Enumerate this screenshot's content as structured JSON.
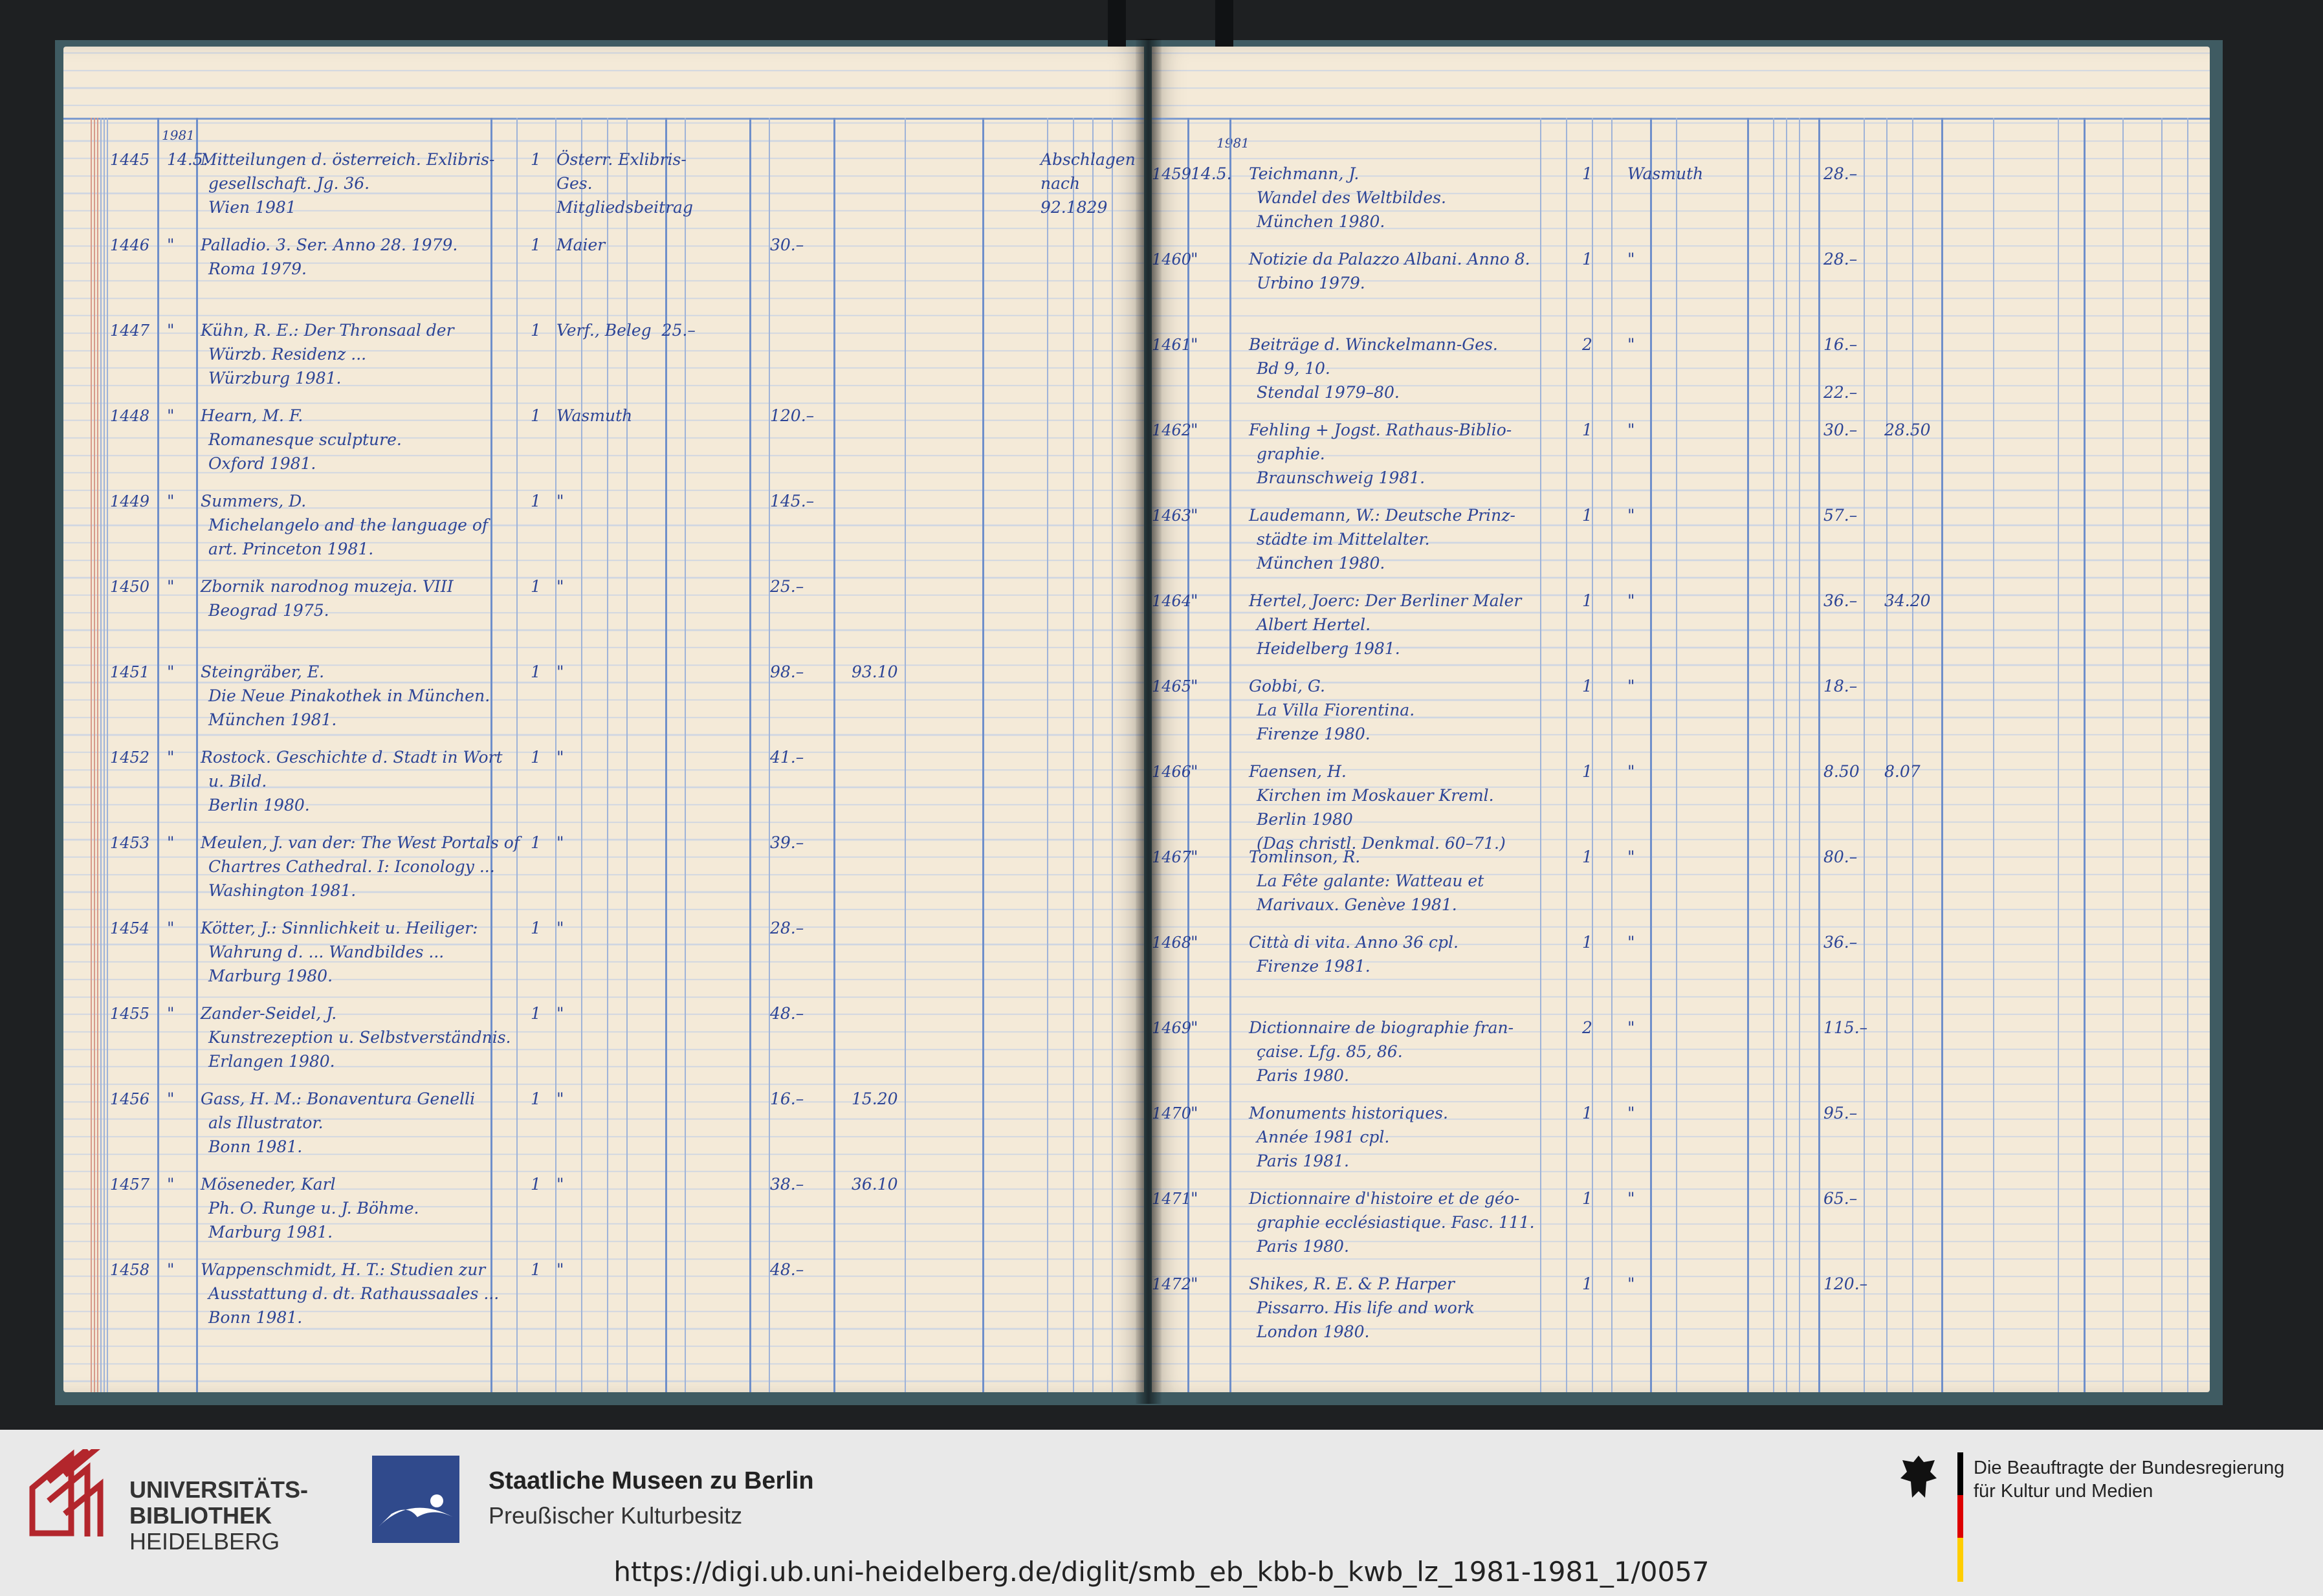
{
  "header": {
    "year_left": "1981",
    "year_right": "1981"
  },
  "left_entries": [
    {
      "no": "1445",
      "date": "14.5.",
      "title": [
        "Mitteilungen d. österreich. Exlibris-",
        "gesellschaft. Jg. 36.",
        "Wien 1981"
      ],
      "qty": "1",
      "supplier": [
        "Österr. Exlibris-",
        "Ges.",
        "Mitgliedsbeitrag"
      ],
      "price": "",
      "remark": [
        "Abschlagen",
        "nach",
        "92.1829"
      ]
    },
    {
      "no": "1446",
      "date": "\"",
      "title": [
        "Palladio. 3. Ser. Anno 28. 1979.",
        "Roma 1979."
      ],
      "qty": "1",
      "supplier": [
        "Maier"
      ],
      "price": "30.–",
      "remark": []
    },
    {
      "no": "1447",
      "date": "\"",
      "title": [
        "Kühn, R. E.: Der Thronsaal der",
        "Würzb. Residenz ...",
        "Würzburg 1981."
      ],
      "qty": "1",
      "supplier": [
        "Verf., Beleg  25.–"
      ],
      "price": "",
      "remark": []
    },
    {
      "no": "1448",
      "date": "\"",
      "title": [
        "Hearn, M. F.",
        "Romanesque sculpture.",
        "Oxford 1981."
      ],
      "qty": "1",
      "supplier": [
        "Wasmuth"
      ],
      "price": "120.–",
      "remark": []
    },
    {
      "no": "1449",
      "date": "\"",
      "title": [
        "Summers, D.",
        "Michelangelo and the language of",
        "art. Princeton 1981."
      ],
      "qty": "1",
      "supplier": [
        "\""
      ],
      "price": "145.–",
      "remark": []
    },
    {
      "no": "1450",
      "date": "\"",
      "title": [
        "Zbornik narodnog muzeja. VIII",
        "Beograd 1975."
      ],
      "qty": "1",
      "supplier": [
        "\""
      ],
      "price": "25.–",
      "remark": []
    },
    {
      "no": "1451",
      "date": "\"",
      "title": [
        "Steingräber, E.",
        "Die Neue Pinakothek in München.",
        "München 1981."
      ],
      "qty": "1",
      "supplier": [
        "\""
      ],
      "price": "98.–",
      "net": "93.10",
      "remark": []
    },
    {
      "no": "1452",
      "date": "\"",
      "title": [
        "Rostock. Geschichte d. Stadt in Wort",
        "u. Bild.",
        "Berlin 1980."
      ],
      "qty": "1",
      "supplier": [
        "\""
      ],
      "price": "41.–",
      "remark": []
    },
    {
      "no": "1453",
      "date": "\"",
      "title": [
        "Meulen, J. van der: The West Portals of",
        "Chartres Cathedral. I: Iconology ...",
        "Washington 1981."
      ],
      "qty": "1",
      "supplier": [
        "\""
      ],
      "price": "39.–",
      "remark": []
    },
    {
      "no": "1454",
      "date": "\"",
      "title": [
        "Kötter, J.: Sinnlichkeit u. Heiliger:",
        "Wahrung d. ... Wandbildes ...",
        "Marburg 1980."
      ],
      "qty": "1",
      "supplier": [
        "\""
      ],
      "price": "28.–",
      "remark": []
    },
    {
      "no": "1455",
      "date": "\"",
      "title": [
        "Zander-Seidel, J.",
        "Kunstrezeption u. Selbstverständnis.",
        "Erlangen 1980."
      ],
      "qty": "1",
      "supplier": [
        "\""
      ],
      "price": "48.–",
      "remark": []
    },
    {
      "no": "1456",
      "date": "\"",
      "title": [
        "Gass, H. M.: Bonaventura Genelli",
        "als Illustrator.",
        "Bonn 1981."
      ],
      "qty": "1",
      "supplier": [
        "\""
      ],
      "price": "16.–",
      "net": "15.20",
      "remark": []
    },
    {
      "no": "1457",
      "date": "\"",
      "title": [
        "Möseneder, Karl",
        "Ph. O. Runge u. J. Böhme.",
        "Marburg 1981."
      ],
      "qty": "1",
      "supplier": [
        "\""
      ],
      "price": "38.–",
      "net": "36.10",
      "remark": []
    },
    {
      "no": "1458",
      "date": "\"",
      "title": [
        "Wappenschmidt, H. T.: Studien zur",
        "Ausstattung d. dt. Rathaussaales ...",
        "Bonn 1981."
      ],
      "qty": "1",
      "supplier": [
        "\""
      ],
      "price": "48.–",
      "remark": []
    }
  ],
  "right_entries": [
    {
      "no": "1459",
      "date": "14.5.",
      "title": [
        "Teichmann, J.",
        "Wandel des Weltbildes.",
        "München 1980."
      ],
      "qty": "1",
      "supplier": [
        "Wasmuth"
      ],
      "price": "28.–"
    },
    {
      "no": "1460",
      "date": "\"",
      "title": [
        "Notizie da Palazzo Albani. Anno 8.",
        "Urbino 1979."
      ],
      "qty": "1",
      "supplier": [
        "\""
      ],
      "price": "28.–"
    },
    {
      "no": "1461",
      "date": "\"",
      "title": [
        "Beiträge d. Winckelmann-Ges.",
        "Bd 9, 10.",
        "Stendal 1979–80."
      ],
      "qty": "2",
      "supplier": [
        "\""
      ],
      "price": "16.–",
      "price2": "22.–"
    },
    {
      "no": "1462",
      "date": "\"",
      "title": [
        "Fehling + Jogst. Rathaus-Biblio-",
        "graphie.",
        "Braunschweig 1981."
      ],
      "qty": "1",
      "supplier": [
        "\""
      ],
      "price": "30.–",
      "net": "28.50"
    },
    {
      "no": "1463",
      "date": "\"",
      "title": [
        "Laudemann, W.: Deutsche Prinz-",
        "städte im Mittelalter.",
        "München 1980."
      ],
      "qty": "1",
      "supplier": [
        "\""
      ],
      "price": "57.–"
    },
    {
      "no": "1464",
      "date": "\"",
      "title": [
        "Hertel, Joerc: Der Berliner Maler",
        "Albert Hertel.",
        "Heidelberg 1981."
      ],
      "qty": "1",
      "supplier": [
        "\""
      ],
      "price": "36.–",
      "net": "34.20"
    },
    {
      "no": "1465",
      "date": "\"",
      "title": [
        "Gobbi, G.",
        "La Villa Fiorentina.",
        "Firenze 1980."
      ],
      "qty": "1",
      "supplier": [
        "\""
      ],
      "price": "18.–"
    },
    {
      "no": "1466",
      "date": "\"",
      "title": [
        "Faensen, H.",
        "Kirchen im Moskauer Kreml.",
        "Berlin 1980",
        "(Das christl. Denkmal. 60–71.)"
      ],
      "qty": "1",
      "supplier": [
        "\""
      ],
      "price": "8.50",
      "net": "8.07"
    },
    {
      "no": "1467",
      "date": "\"",
      "title": [
        "Tomlinson, R.",
        "La Fête galante: Watteau et",
        "Marivaux. Genève 1981."
      ],
      "qty": "1",
      "supplier": [
        "\""
      ],
      "price": "80.–"
    },
    {
      "no": "1468",
      "date": "\"",
      "title": [
        "Città di vita. Anno 36 cpl.",
        "Firenze 1981."
      ],
      "qty": "1",
      "supplier": [
        "\""
      ],
      "price": "36.–"
    },
    {
      "no": "1469",
      "date": "\"",
      "title": [
        "Dictionnaire de biographie fran-",
        "çaise. Lfg. 85, 86.",
        "Paris 1980."
      ],
      "qty": "2",
      "supplier": [
        "\""
      ],
      "price": "115.–"
    },
    {
      "no": "1470",
      "date": "\"",
      "title": [
        "Monuments historiques.",
        "Année 1981 cpl.",
        "Paris 1981."
      ],
      "qty": "1",
      "supplier": [
        "\""
      ],
      "price": "95.–"
    },
    {
      "no": "1471",
      "date": "\"",
      "title": [
        "Dictionnaire d'histoire et de géo-",
        "graphie ecclésiastique. Fasc. 111.",
        "Paris 1980."
      ],
      "qty": "1",
      "supplier": [
        "\""
      ],
      "price": "65.–"
    },
    {
      "no": "1472",
      "date": "\"",
      "title": [
        "Shikes, R. E. & P. Harper",
        "Pissarro. His life and work",
        "London 1980."
      ],
      "qty": "1",
      "supplier": [
        "\""
      ],
      "price": "120.–"
    }
  ],
  "footer": {
    "ub_logo": {
      "line1": "UNIVERSITÄTS-",
      "line2": "BIBLIOTHEK",
      "line3": "HEIDELBERG"
    },
    "smb_logo": {
      "line1": "Staatliche Museen zu Berlin",
      "line2": "Preußischer Kulturbesitz"
    },
    "bkm_logo": {
      "line1": "Die Beauftragte der Bundesregierung",
      "line2": "für Kultur und Medien"
    },
    "url": "https://digi.ub.uni-heidelberg.de/diglit/smb_eb_kbb-b_kwb_lz_1981-1981_1/0057"
  }
}
